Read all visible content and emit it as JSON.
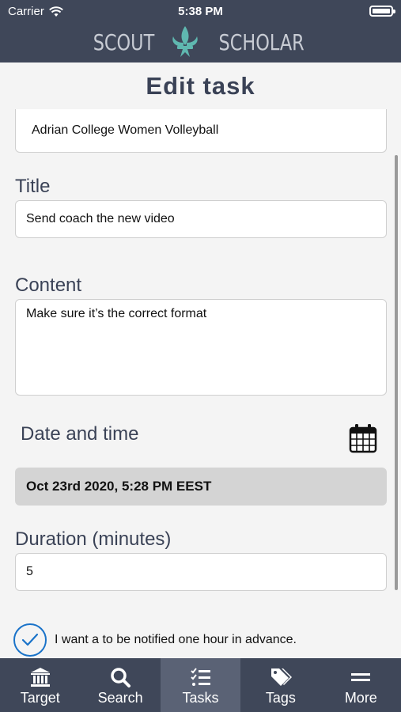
{
  "status_bar": {
    "carrier": "Carrier",
    "time": "5:38 PM"
  },
  "brand": {
    "left": "SCOUT",
    "right": "SCHOLAR"
  },
  "page": {
    "title": "Edit task"
  },
  "form": {
    "target_value": "Adrian College Women Volleyball",
    "title_label": "Title",
    "title_value": "Send coach the new video",
    "content_label": "Content",
    "content_value": "Make sure it’s the correct format",
    "datetime_label": "Date and time",
    "datetime_value": "Oct 23rd 2020, 5:28 PM EEST",
    "duration_label": "Duration (minutes)",
    "duration_value": "5",
    "notify_label": "I want a to be notified one hour in advance.",
    "notify_checked": true
  },
  "tabs": [
    {
      "label": "Target",
      "icon": "bank-icon"
    },
    {
      "label": "Search",
      "icon": "search-icon"
    },
    {
      "label": "Tasks",
      "icon": "tasks-icon",
      "active": true
    },
    {
      "label": "Tags",
      "icon": "tags-icon"
    },
    {
      "label": "More",
      "icon": "menu-icon"
    }
  ],
  "colors": {
    "header": "#3f4759",
    "accent": "#1a73c9",
    "title": "#3a4256"
  }
}
